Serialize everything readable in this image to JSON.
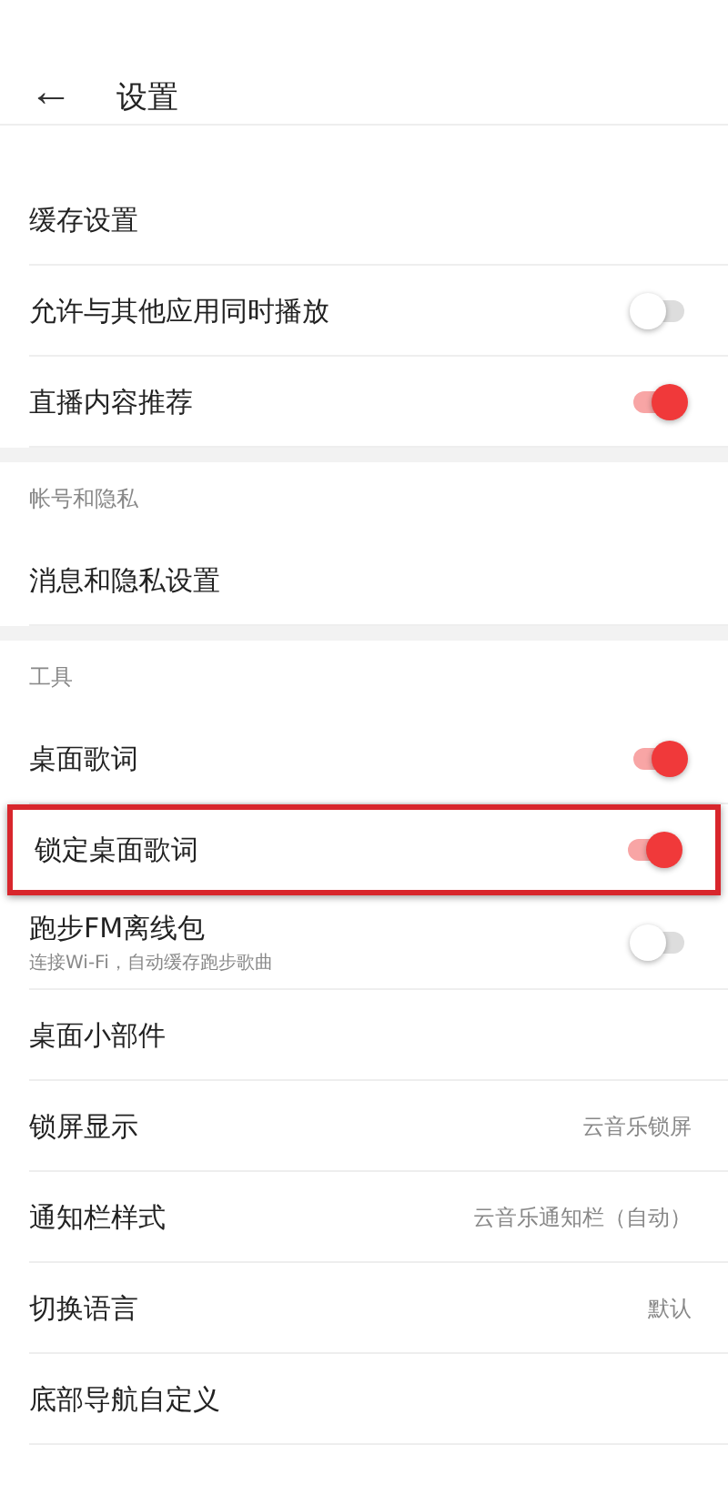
{
  "header": {
    "back": "←",
    "title": "设置"
  },
  "sections": [
    {
      "items": [
        {
          "kind": "link",
          "label": "缓存设置"
        },
        {
          "kind": "toggle",
          "label": "允许与其他应用同时播放",
          "on": false
        },
        {
          "kind": "toggle",
          "label": "直播内容推荐",
          "on": true
        }
      ]
    },
    {
      "title": "帐号和隐私",
      "items": [
        {
          "kind": "link",
          "label": "消息和隐私设置"
        }
      ]
    },
    {
      "title": "工具",
      "items": [
        {
          "kind": "toggle",
          "label": "桌面歌词",
          "on": true
        },
        {
          "kind": "toggle",
          "label": "锁定桌面歌词",
          "on": true,
          "highlighted": true
        },
        {
          "kind": "toggle",
          "label": "跑步FM离线包",
          "subtitle": "连接Wi-Fi，自动缓存跑步歌曲",
          "on": false
        },
        {
          "kind": "link",
          "label": "桌面小部件"
        },
        {
          "kind": "value",
          "label": "锁屏显示",
          "value": "云音乐锁屏"
        },
        {
          "kind": "value",
          "label": "通知栏样式",
          "value": "云音乐通知栏（自动）"
        },
        {
          "kind": "value",
          "label": "切换语言",
          "value": "默认"
        },
        {
          "kind": "link",
          "label": "底部导航自定义"
        }
      ]
    }
  ]
}
